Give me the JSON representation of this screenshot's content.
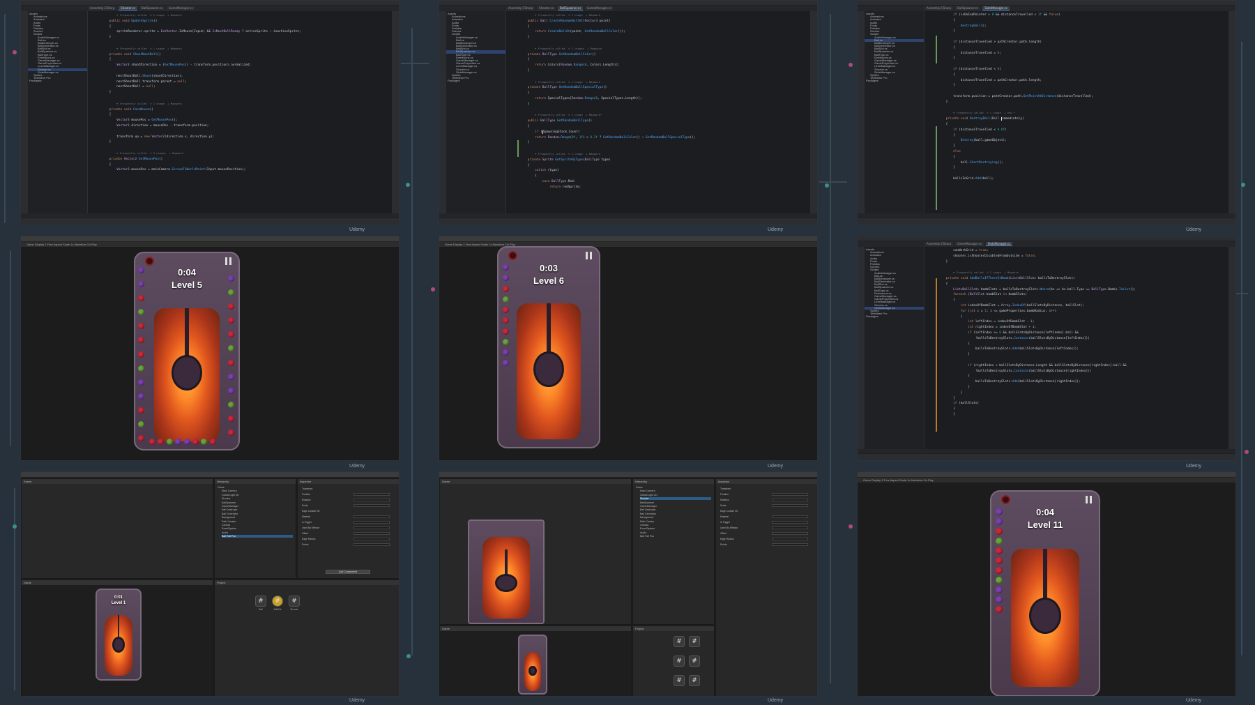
{
  "watermark": "Udemy",
  "ide": {
    "tabs": [
      "Assembly-CSharp",
      "Shooter.cs",
      "BallSpawner.cs",
      "GameManager.cs",
      "SlotsManager.cs"
    ],
    "tree": [
      "Assets",
      "Animations",
      "Animator",
      "Audio",
      "Fonts",
      "Prefabs",
      "Scenes",
      "Scripts",
      "AudioManager.cs",
      "Ball.cs",
      "BallDestroyer.cs",
      "BallGenerator.cs",
      "BallSlot.cs",
      "BallSpawner.cs",
      "BallType.cs",
      "Extensions.cs",
      "GameManager.cs",
      "GameProperties.cs",
      "LevelManager.cs",
      "Shooter.cs",
      "SlotsManager.cs",
      "Sprites",
      "TextMesh Pro",
      "Packages"
    ],
    "code1": [
      {
        "t": "        <span class='hint'>≡ Frequently called  ⊙ 1 usage  ♙ Mapwork</span>"
      },
      {
        "t": "    <span class='kw'>public void</span> <span class='fn'>UpdateSprite</span>()"
      },
      {
        "t": "    {"
      },
      {
        "t": "        spriteRenderer.sprite = <span class='ty'>ExtVector</span>.IsMouse(Input) && <span class='ty'>IsNextBallReady</span> ? activeSprite : inactiveSprite;"
      },
      {
        "t": "    }"
      },
      {
        "t": ""
      },
      {
        "t": "        <span class='hint'>≡ Frequently called  ⊙ 1 usage  ♙ Mapwork</span>"
      },
      {
        "t": "    <span class='kw'>private void</span> <span class='fn'>ShootNextBall</span>()"
      },
      {
        "t": "    {"
      },
      {
        "t": "        <span class='ty'>Vector3</span> shootDirection = (<span class='fn'>GetMousePos</span>() - transform.position).normalized;"
      },
      {
        "t": ""
      },
      {
        "t": "        nextShootBall.<span class='fn'>Shoot</span>(shootDirection);"
      },
      {
        "t": "        nextShootBall.transform.parent = <span class='kw'>null</span>;"
      },
      {
        "t": "        nextShootBall = <span class='kw'>null</span>;"
      },
      {
        "t": "    }"
      },
      {
        "t": ""
      },
      {
        "t": "        <span class='hint'>≡ Frequently called  ⊙ 1 usage  ♙ Mapwork</span>"
      },
      {
        "t": "    <span class='kw'>private void</span> <span class='fn'>FaceMouse</span>()"
      },
      {
        "t": "    {"
      },
      {
        "t": "        <span class='ty'>Vector3</span> mousePos = <span class='fn'>GetMousePos</span>();"
      },
      {
        "t": "        <span class='ty'>Vector3</span> direction = mousePos - transform.position;"
      },
      {
        "t": ""
      },
      {
        "t": "        transform.up = <span class='kw'>new</span> <span class='ty'>Vector2</span>(direction.x, direction.y);"
      },
      {
        "t": "    }"
      },
      {
        "t": ""
      },
      {
        "t": "        <span class='hint'>≡ Frequently called  ⊙ 3 usages  ♙ Mapwork</span>"
      },
      {
        "t": "    <span class='kw'>private</span> <span class='ty'>Vector2</span> <span class='fn'>GetMousePos</span>()"
      },
      {
        "t": "    {"
      },
      {
        "t": "        <span class='ty'>Vector3</span> mousePos = mainCamera.<span class='fn'>ScreenToWorldPoint</span>(Input.mousePosition);"
      }
    ],
    "code2": [
      {
        "t": "        <span class='hint'>≡ Frequently called  ⊙ 1 usage  ♙ Mapwork</span>"
      },
      {
        "t": "    <span class='kw'>public</span> <span class='ty'>Ball</span> <span class='fn'>CreateRandomBallAt</span>(<span class='ty'>Vector3</span> point)"
      },
      {
        "t": "    {"
      },
      {
        "t": "        <span class='kw'>return</span> <span class='fn'>CreateBallAt</span>(point, <span class='fn'>GetRandomBallColor</span>());"
      },
      {
        "t": "    }"
      },
      {
        "t": ""
      },
      {
        "t": "        <span class='hint'>≡ Frequently called  ⊙ 2 usages  ♙ Mapwork</span>"
      },
      {
        "t": "    <span class='kw'>private</span> <span class='ty'>BallType</span> <span class='fn'>GetRandomBallColor</span>()"
      },
      {
        "t": "    {"
      },
      {
        "t": "        <span class='kw'>return</span> Colors[<span class='ty'>Random</span>.<span class='fn'>Range</span>(<span class='nm'>0</span>, Colors.Length)];"
      },
      {
        "t": "    }"
      },
      {
        "t": ""
      },
      {
        "t": "        <span class='hint'>≡ Frequently called  ⊙ 1 usage  ♙ Mapwork</span>"
      },
      {
        "t": "    <span class='kw'>private</span> <span class='ty'>BallType</span> <span class='fn'>GetRandomBallSpecialType</span>()"
      },
      {
        "t": "    {"
      },
      {
        "t": "        <span class='kw'>return</span> SpecialTypes[<span class='ty'>Random</span>.<span class='fn'>Range</span>(<span class='nm'>0</span>, SpecialTypes.Length)];"
      },
      {
        "t": "    }"
      },
      {
        "t": ""
      },
      {
        "t": "        <span class='hint'>≡ Frequently called  ⊙ 1 usage  ♙ Mapwork*</span>"
      },
      {
        "t": "    <span class='kw'>public</span> <span class='ty'>BallType</span> <span class='fn'>GetRandomBallType</span>()"
      },
      {
        "t": "    {"
      },
      {
        "t": "        <span class='kw'>if</span> (<span class='caret'></span>SpawningStack.Count)"
      },
      {
        "t": "        <span class='kw'>return</span> <span class='ty'>Random</span>.<span class='fn'>Range</span>(<span class='nm'>0f</span>, <span class='nm'>1f</span>) > <span class='nm'>0.2f</span> ? <span class='fn'>GetRandomBallColor</span>() : <span class='fn'>GetRandomBallSpecialType</span>();"
      },
      {
        "t": "    }"
      },
      {
        "t": ""
      },
      {
        "t": "        <span class='hint'>≡ Frequently called  ⊙ 1 usage  ♙ Mapwork</span>"
      },
      {
        "t": "    <span class='kw'>private</span> <span class='ty'>Sprite</span> <span class='fn'>GetSpriteByType</span>(<span class='ty'>BallType</span> type)"
      },
      {
        "t": "    {"
      },
      {
        "t": "        <span class='kw'>switch</span> (type)"
      },
      {
        "t": "        {"
      },
      {
        "t": "            <span class='kw'>case</span> <span class='ty'>BallType</span>.Red:"
      },
      {
        "t": "                <span class='kw'>return</span> redSprite;"
      }
    ],
    "code3": [
      {
        "t": "        <span class='kw'>if</span> (isOnEndPointer > <span class='nm'>0</span> && distanceTravelled < <span class='nm'>1f</span> && <span class='kw'>false</span>)"
      },
      {
        "t": "        {"
      },
      {
        "t": "            <span class='fn'>DestroyBall</span>();"
      },
      {
        "t": "        }"
      },
      {
        "t": ""
      },
      {
        "t": "        <span class='kw'>if</span> (distanceTravelled > pathCreator.path.length)"
      },
      {
        "t": "        {"
      },
      {
        "t": "            distanceTravelled = <span class='nm'>0</span>;"
      },
      {
        "t": "        }"
      },
      {
        "t": ""
      },
      {
        "t": "        <span class='kw'>if</span> (distanceTravelled < <span class='nm'>0</span>)"
      },
      {
        "t": "        {"
      },
      {
        "t": "            distanceTravelled = pathCreator.path.length;"
      },
      {
        "t": "        }"
      },
      {
        "t": ""
      },
      {
        "t": "        transform.position = pathCreator.path.<span class='fn'>GetPointAtDistance</span>(distanceTravelled);"
      },
      {
        "t": "    }"
      },
      {
        "t": ""
      },
      {
        "t": "        <span class='hint'>≡ Frequently called  ⊙ 1 usage  ♙ new *</span>"
      },
      {
        "t": "    <span class='kw'>private void</span> <span class='fn'>DestroyBall</span>(<span class='ty'>Ball</span> <span class='caret'></span>immediately)"
      },
      {
        "t": "    {"
      },
      {
        "t": "        <span class='kw'>if</span> (distanceTravelled < <span class='nm'>0.6f</span>)"
      },
      {
        "t": "        {"
      },
      {
        "t": "            <span class='fn'>Destroy</span>(ball.gameObject);"
      },
      {
        "t": "        }"
      },
      {
        "t": "        <span class='kw'>else</span>"
      },
      {
        "t": "        {"
      },
      {
        "t": "            ball.<span class='fn'>StartDestroying</span>();"
      },
      {
        "t": "        }"
      },
      {
        "t": ""
      },
      {
        "t": "        ballsInGrid.<span class='fn'>Add</span>(ball);"
      }
    ],
    "code6": [
      {
        "t": "        canWorkGrid = <span class='kw'>true</span>;"
      },
      {
        "t": "        shooter.isShooterDisabledFromOutside = <span class='kw'>false</span>;"
      },
      {
        "t": "    }"
      },
      {
        "t": ""
      },
      {
        "t": "        <span class='hint'>≡ Frequently called  ⊙ 1 usage  ♙ Mapwork</span>"
      },
      {
        "t": "    <span class='kw'>private void</span> <span class='fn'>AddBallsIfThereIsBomb</span>(<span class='ty'>List</span>&lt;<span class='ty'>BallSlot</span>&gt; ballsToDestroySlots)"
      },
      {
        "t": "    {"
      },
      {
        "t": "        <span class='ty'>List</span>&lt;<span class='ty'>BallSlot</span>&gt; bombSlots = ballsToDestroySlots.<span class='fn'>Where</span>(bs => bs.ball.Type == <span class='ty'>BallType</span>.Bomb).<span class='fn'>ToList</span>();"
      },
      {
        "t": "        <span class='kw'>foreach</span> (<span class='ty'>BallSlot</span> bombSlot <span class='kw'>in</span> bombSlots)"
      },
      {
        "t": "        {"
      },
      {
        "t": "            <span class='kw'>int</span> indexOfBombSlot = <span class='ty'>Array</span>.<span class='fn'>IndexOf</span>(ballSlotsByDistance, ballSlot);"
      },
      {
        "t": "            <span class='kw'>for</span> (<span class='kw'>int</span> i = <span class='nm'>1</span>; i <= gameProperties.bombRadius; i++)"
      },
      {
        "t": "            {"
      },
      {
        "t": "                <span class='kw'>int</span> leftIndex = indexOfBombSlot - i;"
      },
      {
        "t": "                <span class='kw'>int</span> rightIndex = indexOfBombSlot + i;"
      },
      {
        "t": "                <span class='kw'>if</span> (leftIndex >= <span class='nm'>0</span> && ballSlotsByDistance[leftIndex].ball &&"
      },
      {
        "t": "                    !ballsToDestroySlots.<span class='fn'>Contains</span>(ballSlotsByDistance[leftIndex]))"
      },
      {
        "t": "                {"
      },
      {
        "t": "                    ballsToDestroySlots.<span class='fn'>Add</span>(ballSlotsByDistance[leftIndex]);"
      },
      {
        "t": "                }"
      },
      {
        "t": ""
      },
      {
        "t": "                <span class='kw'>if</span> (rightIndex < ballSlotsByDistance.Length && ballSlotsByDistance[rightIndex].ball &&"
      },
      {
        "t": "                    !ballsToDestroySlots.<span class='fn'>Contains</span>(ballSlotsByDistance[rightIndex]))"
      },
      {
        "t": "                {"
      },
      {
        "t": "                    ballsToDestroySlots.<span class='fn'>Add</span>(ballSlotsByDistance[rightIndex]);"
      },
      {
        "t": "                }"
      },
      {
        "t": "            }"
      },
      {
        "t": "        }"
      },
      {
        "t": "        <span class='kw'>if</span> (ballSlots)"
      },
      {
        "t": "        {"
      },
      {
        "t": "        }"
      }
    ]
  },
  "games": {
    "g4": {
      "time": "0:04",
      "level": "Level 5"
    },
    "g5": {
      "time": "0:03",
      "level": "Level 6"
    },
    "g7": {
      "time": "0:01",
      "level": "Level 1"
    },
    "g9": {
      "time": "0:04",
      "level": "Level 11"
    }
  },
  "unity": {
    "bar_label": "Game  Display 1  Free Aspect  Scale 1x  Maximize On Play",
    "panels": {
      "scene": "Scene",
      "game": "Game",
      "hierarchy": "Hierarchy",
      "inspector": "Inspector",
      "project": "Project",
      "console": "Console"
    },
    "hierarchy": [
      "Game",
      "Main Camera",
      "Global Light 2D",
      "Shooter",
      "BallSpawner",
      "GameManager",
      "Ball Destroyer",
      "Ball Generator",
      "Background",
      "Path Creator",
      "Canvas",
      "EventSystem",
      "Audio",
      "Ball Fall Pos"
    ],
    "inspector_rows": [
      "Transform",
      "Position",
      "Rotation",
      "Scale",
      "Edge Collider 2D",
      "Material",
      "Is Trigger",
      "Used By Effector",
      "Offset",
      "Edge Radius",
      "Points"
    ],
    "add_component": "Add Component",
    "assets": [
      {
        "icon": "#",
        "label": "Ball"
      },
      {
        "icon": "#",
        "label": "BallSlot"
      },
      {
        "icon": "#",
        "label": "Shooter"
      }
    ],
    "prefabs": [
      {
        "label": "Ball"
      },
      {
        "label": "BallSlot"
      },
      {
        "label": "Bomb"
      }
    ]
  }
}
